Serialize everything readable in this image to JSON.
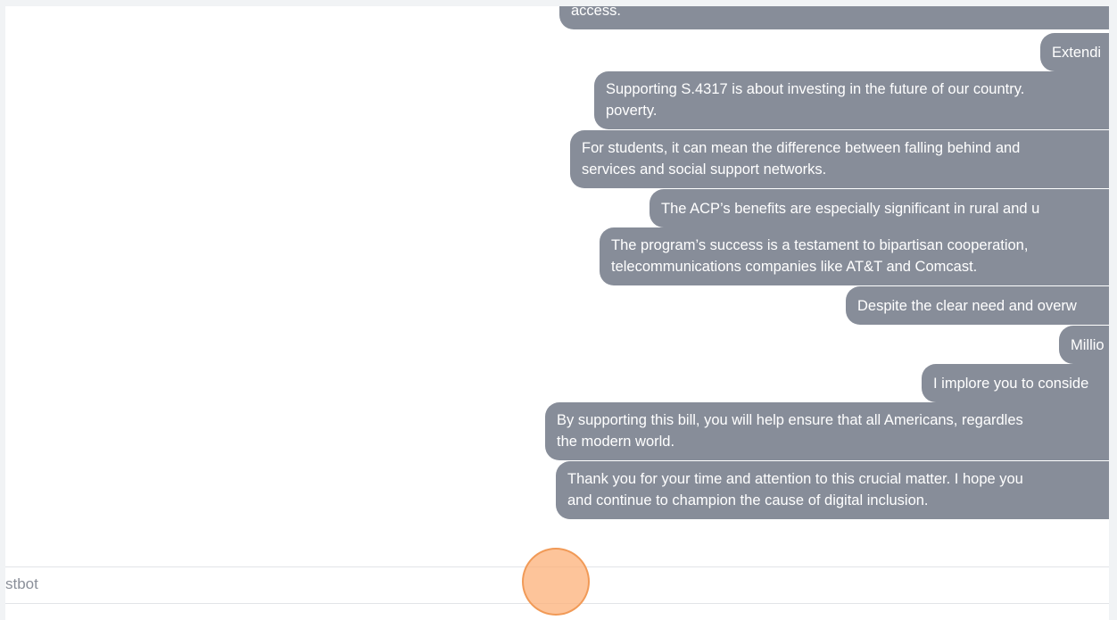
{
  "messages": [
    {
      "lines": [
        "access."
      ]
    },
    {
      "lines": [
        "Extendi"
      ]
    },
    {
      "lines": [
        "Supporting S.4317 is about investing in the future of our country.",
        "poverty."
      ]
    },
    {
      "lines": [
        "For students, it can mean the difference between falling behind and",
        "services and social support networks."
      ]
    },
    {
      "lines": [
        "The ACP’s benefits are especially significant in rural and u"
      ]
    },
    {
      "lines": [
        "The program’s success is a testament to bipartisan cooperation,",
        "telecommunications companies like AT&T and Comcast."
      ]
    },
    {
      "lines": [
        "Despite the clear need and overw"
      ]
    },
    {
      "lines": [
        "Millio"
      ]
    },
    {
      "lines": [
        "I implore you to conside"
      ]
    },
    {
      "lines": [
        "By supporting this bill, you will help ensure that all Americans, regardles",
        "the modern world."
      ]
    },
    {
      "lines": [
        "Thank you for your time and attention to this crucial matter. I hope you",
        "and continue to champion the cause of digital inclusion."
      ]
    }
  ],
  "bottom_bar": {
    "label": "stbot"
  },
  "colors": {
    "bubble": "#878d99",
    "bubble_text": "#ffffff",
    "cursor_highlight": "#fcb078"
  }
}
